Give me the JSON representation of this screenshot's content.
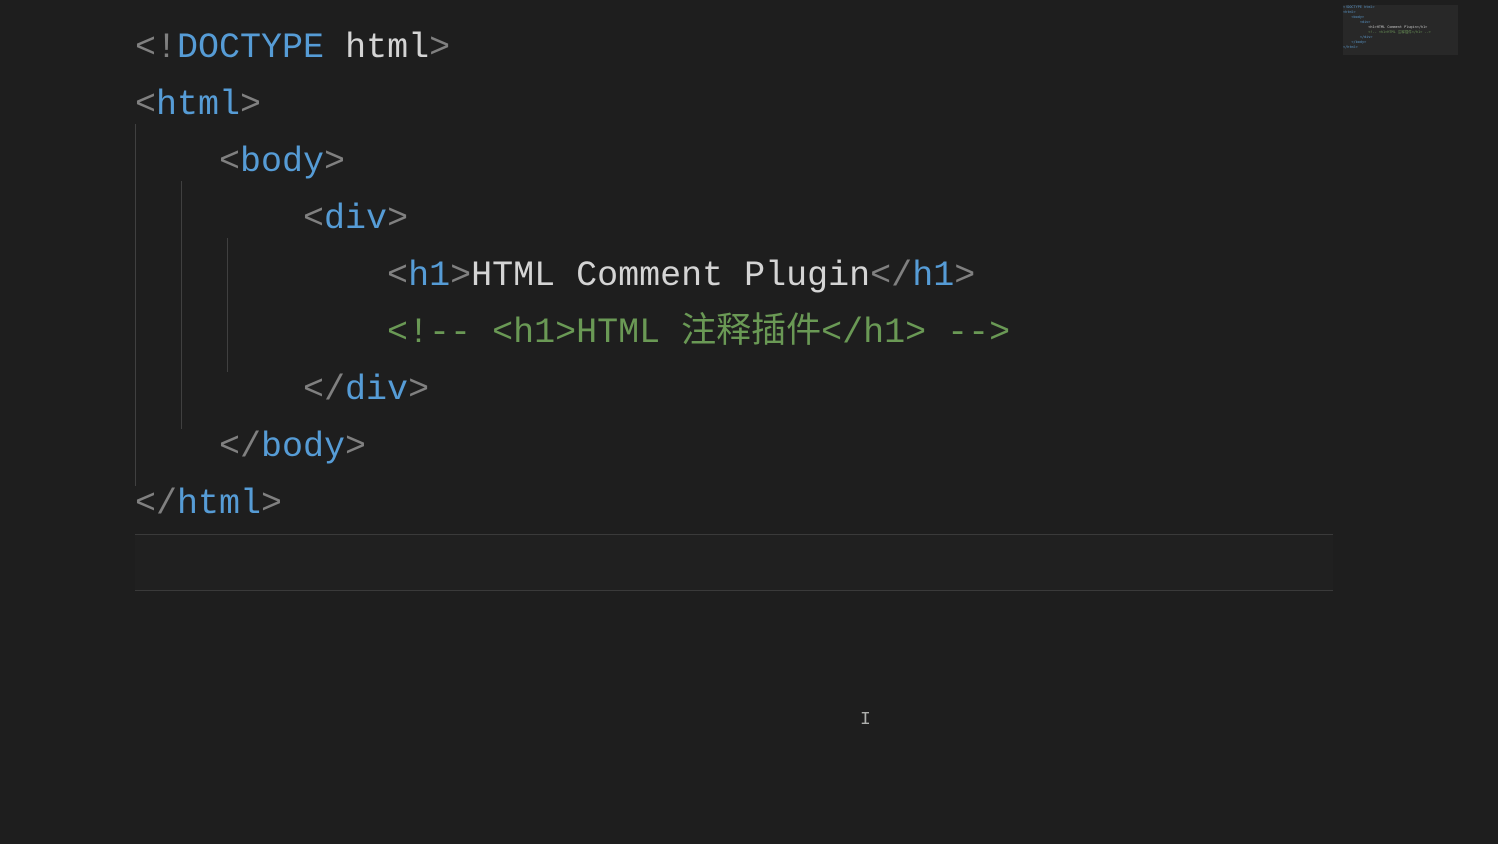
{
  "code": {
    "line1": {
      "open_bang": "<!",
      "doctype": "DOCTYPE",
      "space": " ",
      "val": "html",
      "close": ">"
    },
    "line2": {
      "open": "<",
      "tag": "html",
      "close": ">"
    },
    "line3": {
      "indent": "    ",
      "open": "<",
      "tag": "body",
      "close": ">"
    },
    "line4": {
      "indent": "        ",
      "open": "<",
      "tag": "div",
      "close": ">"
    },
    "line5": {
      "indent": "            ",
      "open": "<",
      "tag_open": "h1",
      "close1": ">",
      "text": "HTML Comment Plugin",
      "open2": "</",
      "tag_close": "h1",
      "close2": ">"
    },
    "line6": {
      "indent": "            ",
      "comment": "<!-- <h1>HTML 注释插件</h1> -->"
    },
    "line7": {
      "indent": "        ",
      "open": "</",
      "tag": "div",
      "close": ">"
    },
    "line8": {
      "indent": "    ",
      "open": "</",
      "tag": "body",
      "close": ">"
    },
    "line9": {
      "open": "</",
      "tag": "html",
      "close": ">"
    }
  },
  "minimap": {
    "l1": "<!DOCTYPE html>",
    "l2": "<html>",
    "l3": "    <body>",
    "l4": "        <div>",
    "l5": "            <h1>HTML Comment Plugin</h1>",
    "l6": "            <!-- <h1>HTML 注释插件</h1> -->",
    "l7": "        </div>",
    "l8": "    </body>",
    "l9": "</html>"
  }
}
